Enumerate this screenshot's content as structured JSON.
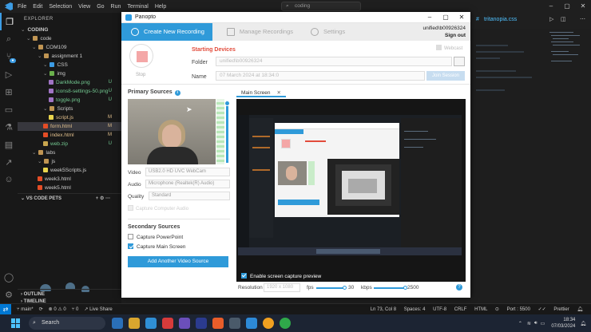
{
  "vscode": {
    "menu": [
      "File",
      "Edit",
      "Selection",
      "View",
      "Go",
      "Run",
      "Terminal",
      "Help"
    ],
    "search": "coding",
    "explorer_title": "EXPLORER",
    "tree": [
      {
        "label": "CODING",
        "depth": 0,
        "kind": "root",
        "status": ""
      },
      {
        "label": "code",
        "depth": 1,
        "kind": "folder",
        "status": ""
      },
      {
        "label": "COM109",
        "depth": 2,
        "kind": "folder",
        "status": ""
      },
      {
        "label": "assignment 1",
        "depth": 3,
        "kind": "folder",
        "status": ""
      },
      {
        "label": "CSS",
        "depth": 4,
        "kind": "folder",
        "status": ""
      },
      {
        "label": "img",
        "depth": 4,
        "kind": "folder",
        "status": ""
      },
      {
        "label": "DarkMode.png",
        "depth": 5,
        "kind": "img",
        "status": "U"
      },
      {
        "label": "icons8-settings-50.png",
        "depth": 5,
        "kind": "img",
        "status": "U"
      },
      {
        "label": "toggle.png",
        "depth": 5,
        "kind": "img",
        "status": "U"
      },
      {
        "label": "Scripts",
        "depth": 4,
        "kind": "folder",
        "status": ""
      },
      {
        "label": "script.js",
        "depth": 5,
        "kind": "js",
        "status": "M"
      },
      {
        "label": "form.html",
        "depth": 4,
        "kind": "html",
        "status": "M"
      },
      {
        "label": "index.html",
        "depth": 4,
        "kind": "html",
        "status": "M"
      },
      {
        "label": "web.zip",
        "depth": 4,
        "kind": "zip",
        "status": "U"
      },
      {
        "label": "labs",
        "depth": 2,
        "kind": "folder",
        "status": ""
      },
      {
        "label": "js",
        "depth": 3,
        "kind": "folder",
        "status": ""
      },
      {
        "label": "week5Scripts.js",
        "depth": 4,
        "kind": "js",
        "status": ""
      },
      {
        "label": "week3.html",
        "depth": 3,
        "kind": "html",
        "status": ""
      },
      {
        "label": "week5.html",
        "depth": 3,
        "kind": "html",
        "status": ""
      }
    ],
    "pets_header": "VS CODE PETS",
    "outline": "OUTLINE",
    "timeline": "TIMELINE",
    "tab": "tritanopia.css",
    "status": {
      "branch": "main*",
      "sync": "⟳",
      "problems": "⊗ 0 ⚠ 0",
      "ports": "⑂ 0",
      "live_share": "Live Share",
      "position": "Ln 73, Col 8",
      "spaces": "Spaces: 4",
      "encoding": "UTF-8",
      "eol": "CRLF",
      "lang": "HTML",
      "port": "Port : 5500",
      "prettier": "Prettier"
    }
  },
  "panopto": {
    "title": "Panopto",
    "tabs": [
      {
        "label": "Create New Recording",
        "active": true
      },
      {
        "label": "Manage Recordings",
        "active": false
      },
      {
        "label": "Settings",
        "active": false
      }
    ],
    "user": "unified\\b00926324",
    "signout": "Sign out",
    "record_label": "Stop",
    "starting": "Starting Devices",
    "folder_label": "Folder",
    "folder_value": "unified\\b00926324",
    "name_label": "Name",
    "name_value": "07 March 2024 at 18:34:0",
    "join_label": "Join Session",
    "webcast": "Webcast",
    "primary_sources": "Primary Sources",
    "video_label": "Video",
    "video_value": "USB2.0 HD UVC WebCam",
    "audio_label": "Audio",
    "audio_value": "Microphone (Realtek(R) Audio)",
    "quality_label": "Quality",
    "quality_value": "Standard",
    "capture_audio": "Capture Computer Audio",
    "secondary_sources": "Secondary Sources",
    "capture_ppt": "Capture PowerPoint",
    "capture_main": "Capture Main Screen",
    "capture_ppt_checked": false,
    "capture_main_checked": true,
    "add_source": "Add Another Video Source",
    "main_screen_tab": "Main Screen",
    "enable_preview": "Enable screen capture preview",
    "resolution_label": "Resolution",
    "resolution_value": "1920 x 1080",
    "fps_label": "fps",
    "fps_value": "30",
    "kbps_label": "kbps",
    "kbps_value": "2500"
  },
  "taskbar": {
    "search": "Search",
    "time": "18:34",
    "date": "07/03/2024"
  },
  "colors": {
    "accent": "#2f9ad9",
    "vscode_blue": "#0078d4",
    "starting_red": "#e24b3b",
    "git_untracked": "#73c991",
    "git_modified": "#e2c08d"
  }
}
